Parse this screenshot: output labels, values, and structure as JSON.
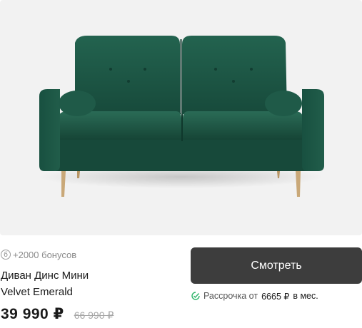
{
  "product": {
    "image_alt": "sofa-emerald-velvet",
    "bonus_badge": "б",
    "bonus_text": "+2000 бонусов",
    "title_line1": "Диван Динс Мини",
    "title_line2": "Velvet Emerald",
    "price": "39 990 ₽",
    "old_price": "66 990 ₽",
    "view_button": "Смотреть",
    "installment_prefix": "Рассрочка от",
    "installment_amount": "6665 ₽",
    "installment_suffix": "в мес."
  },
  "colors": {
    "sofa": "#1f5b4a",
    "button": "#3d3d3d",
    "installment_check": "#2fb56a",
    "image_bg": "#f2f2f2"
  },
  "icons": [
    "bonus-coin-icon",
    "check-circle-icon"
  ]
}
